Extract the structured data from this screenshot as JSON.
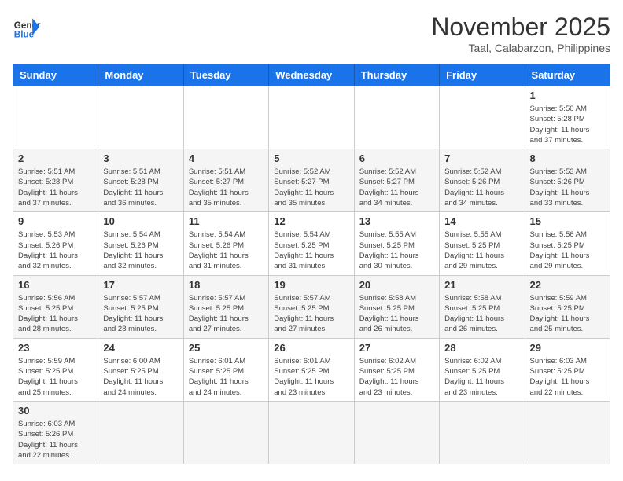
{
  "header": {
    "logo_general": "General",
    "logo_blue": "Blue",
    "month_title": "November 2025",
    "location": "Taal, Calabarzon, Philippines"
  },
  "days_of_week": [
    "Sunday",
    "Monday",
    "Tuesday",
    "Wednesday",
    "Thursday",
    "Friday",
    "Saturday"
  ],
  "weeks": [
    [
      {
        "day": "",
        "info": ""
      },
      {
        "day": "",
        "info": ""
      },
      {
        "day": "",
        "info": ""
      },
      {
        "day": "",
        "info": ""
      },
      {
        "day": "",
        "info": ""
      },
      {
        "day": "",
        "info": ""
      },
      {
        "day": "1",
        "info": "Sunrise: 5:50 AM\nSunset: 5:28 PM\nDaylight: 11 hours\nand 37 minutes."
      }
    ],
    [
      {
        "day": "2",
        "info": "Sunrise: 5:51 AM\nSunset: 5:28 PM\nDaylight: 11 hours\nand 37 minutes."
      },
      {
        "day": "3",
        "info": "Sunrise: 5:51 AM\nSunset: 5:28 PM\nDaylight: 11 hours\nand 36 minutes."
      },
      {
        "day": "4",
        "info": "Sunrise: 5:51 AM\nSunset: 5:27 PM\nDaylight: 11 hours\nand 35 minutes."
      },
      {
        "day": "5",
        "info": "Sunrise: 5:52 AM\nSunset: 5:27 PM\nDaylight: 11 hours\nand 35 minutes."
      },
      {
        "day": "6",
        "info": "Sunrise: 5:52 AM\nSunset: 5:27 PM\nDaylight: 11 hours\nand 34 minutes."
      },
      {
        "day": "7",
        "info": "Sunrise: 5:52 AM\nSunset: 5:26 PM\nDaylight: 11 hours\nand 34 minutes."
      },
      {
        "day": "8",
        "info": "Sunrise: 5:53 AM\nSunset: 5:26 PM\nDaylight: 11 hours\nand 33 minutes."
      }
    ],
    [
      {
        "day": "9",
        "info": "Sunrise: 5:53 AM\nSunset: 5:26 PM\nDaylight: 11 hours\nand 32 minutes."
      },
      {
        "day": "10",
        "info": "Sunrise: 5:54 AM\nSunset: 5:26 PM\nDaylight: 11 hours\nand 32 minutes."
      },
      {
        "day": "11",
        "info": "Sunrise: 5:54 AM\nSunset: 5:26 PM\nDaylight: 11 hours\nand 31 minutes."
      },
      {
        "day": "12",
        "info": "Sunrise: 5:54 AM\nSunset: 5:25 PM\nDaylight: 11 hours\nand 31 minutes."
      },
      {
        "day": "13",
        "info": "Sunrise: 5:55 AM\nSunset: 5:25 PM\nDaylight: 11 hours\nand 30 minutes."
      },
      {
        "day": "14",
        "info": "Sunrise: 5:55 AM\nSunset: 5:25 PM\nDaylight: 11 hours\nand 29 minutes."
      },
      {
        "day": "15",
        "info": "Sunrise: 5:56 AM\nSunset: 5:25 PM\nDaylight: 11 hours\nand 29 minutes."
      }
    ],
    [
      {
        "day": "16",
        "info": "Sunrise: 5:56 AM\nSunset: 5:25 PM\nDaylight: 11 hours\nand 28 minutes."
      },
      {
        "day": "17",
        "info": "Sunrise: 5:57 AM\nSunset: 5:25 PM\nDaylight: 11 hours\nand 28 minutes."
      },
      {
        "day": "18",
        "info": "Sunrise: 5:57 AM\nSunset: 5:25 PM\nDaylight: 11 hours\nand 27 minutes."
      },
      {
        "day": "19",
        "info": "Sunrise: 5:57 AM\nSunset: 5:25 PM\nDaylight: 11 hours\nand 27 minutes."
      },
      {
        "day": "20",
        "info": "Sunrise: 5:58 AM\nSunset: 5:25 PM\nDaylight: 11 hours\nand 26 minutes."
      },
      {
        "day": "21",
        "info": "Sunrise: 5:58 AM\nSunset: 5:25 PM\nDaylight: 11 hours\nand 26 minutes."
      },
      {
        "day": "22",
        "info": "Sunrise: 5:59 AM\nSunset: 5:25 PM\nDaylight: 11 hours\nand 25 minutes."
      }
    ],
    [
      {
        "day": "23",
        "info": "Sunrise: 5:59 AM\nSunset: 5:25 PM\nDaylight: 11 hours\nand 25 minutes."
      },
      {
        "day": "24",
        "info": "Sunrise: 6:00 AM\nSunset: 5:25 PM\nDaylight: 11 hours\nand 24 minutes."
      },
      {
        "day": "25",
        "info": "Sunrise: 6:01 AM\nSunset: 5:25 PM\nDaylight: 11 hours\nand 24 minutes."
      },
      {
        "day": "26",
        "info": "Sunrise: 6:01 AM\nSunset: 5:25 PM\nDaylight: 11 hours\nand 23 minutes."
      },
      {
        "day": "27",
        "info": "Sunrise: 6:02 AM\nSunset: 5:25 PM\nDaylight: 11 hours\nand 23 minutes."
      },
      {
        "day": "28",
        "info": "Sunrise: 6:02 AM\nSunset: 5:25 PM\nDaylight: 11 hours\nand 23 minutes."
      },
      {
        "day": "29",
        "info": "Sunrise: 6:03 AM\nSunset: 5:25 PM\nDaylight: 11 hours\nand 22 minutes."
      }
    ],
    [
      {
        "day": "30",
        "info": "Sunrise: 6:03 AM\nSunset: 5:26 PM\nDaylight: 11 hours\nand 22 minutes."
      },
      {
        "day": "",
        "info": ""
      },
      {
        "day": "",
        "info": ""
      },
      {
        "day": "",
        "info": ""
      },
      {
        "day": "",
        "info": ""
      },
      {
        "day": "",
        "info": ""
      },
      {
        "day": "",
        "info": ""
      }
    ]
  ]
}
